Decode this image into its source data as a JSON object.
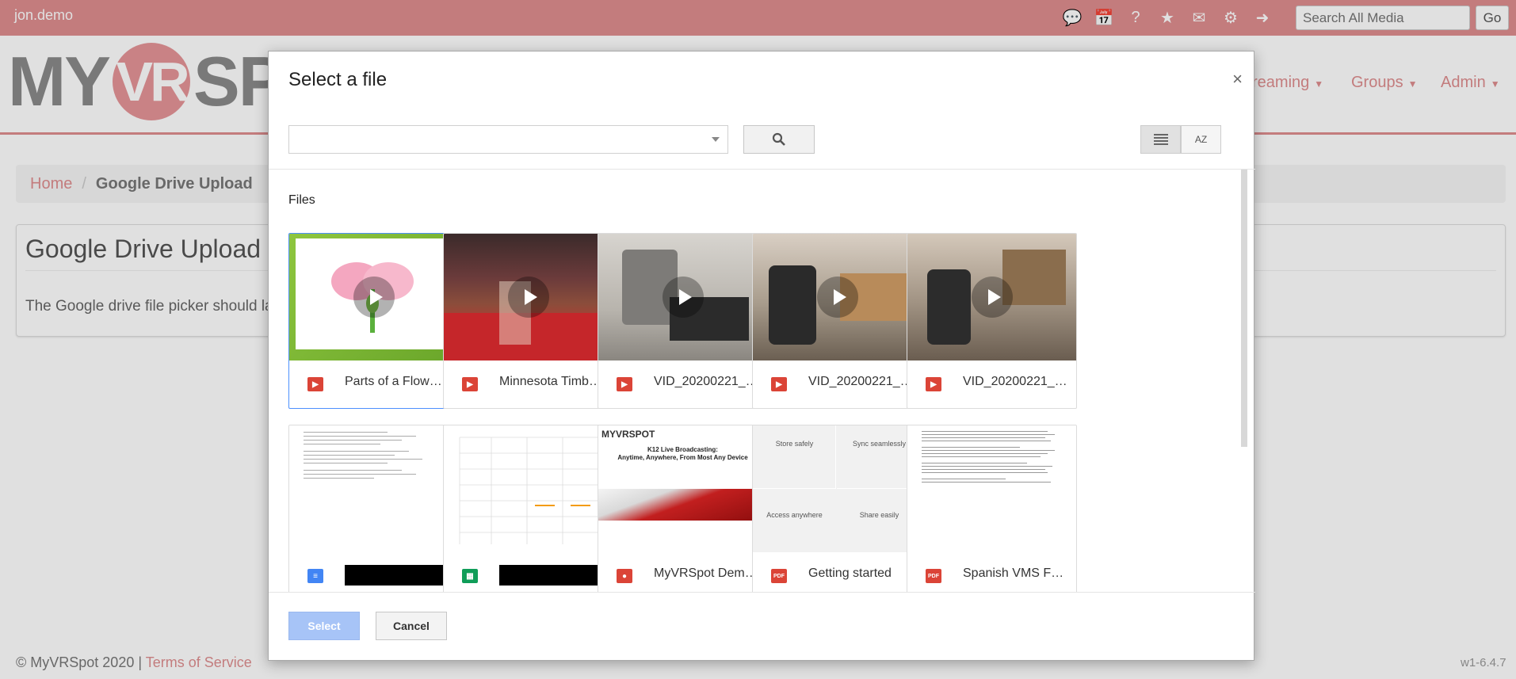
{
  "topbar": {
    "username": "jon.demo",
    "icons": [
      "comments-icon",
      "calendar-icon",
      "help-icon",
      "star-icon",
      "envelope-icon",
      "gear-icon",
      "sign-out-icon"
    ],
    "search_placeholder": "Search All Media",
    "go_label": "Go"
  },
  "header": {
    "logo_left": "MY",
    "logo_vr": "VR",
    "logo_right": "SP",
    "nav": [
      {
        "label": "reaming"
      },
      {
        "label": "Groups"
      },
      {
        "label": "Admin"
      }
    ]
  },
  "breadcrumb": {
    "home": "Home",
    "separator": "/",
    "current": "Google Drive Upload"
  },
  "page": {
    "title": "Google Drive Upload",
    "description": "The Google drive file picker should lau"
  },
  "footer": {
    "copyright": "© MyVRSpot 2020 |",
    "terms": "Terms of Service",
    "version": "w1-6.4.7"
  },
  "modal": {
    "title": "Select a file",
    "close": "×",
    "view_sort_label": "AZ",
    "section_title": "Files",
    "select_label": "Select",
    "cancel_label": "Cancel",
    "files": [
      {
        "name": "Parts of a Flow…",
        "type": "video",
        "selected": true
      },
      {
        "name": "Minnesota Timb…",
        "type": "video"
      },
      {
        "name": "VID_20200221_…",
        "type": "video"
      },
      {
        "name": "VID_20200221_…",
        "type": "video"
      },
      {
        "name": "VID_20200221_…",
        "type": "video"
      },
      {
        "name": "",
        "type": "doc",
        "redacted": true
      },
      {
        "name": "",
        "type": "sheet",
        "redacted": true
      },
      {
        "name": "MyVRSpot Dem…",
        "type": "slides"
      },
      {
        "name": "Getting started",
        "type": "pdf"
      },
      {
        "name": "Spanish VMS F…",
        "type": "pdf"
      }
    ],
    "thumb_texts": {
      "slides_brand": "MYVRSPOT",
      "slides_title": "K12 Live Broadcasting:",
      "slides_subtitle": "Anytime, Anywhere, From Most Any Device",
      "gs_store": "Store safely",
      "gs_sync": "Sync seamlessly",
      "gs_access": "Access anywhere",
      "gs_share": "Share easily"
    }
  },
  "colors": {
    "brand": "#de8e8f",
    "select_button": "#a7c4f7",
    "selected_border": "#4d90fe",
    "video_icon": "#db4437",
    "doc_icon": "#4285f4",
    "sheet_icon": "#0f9d58"
  }
}
